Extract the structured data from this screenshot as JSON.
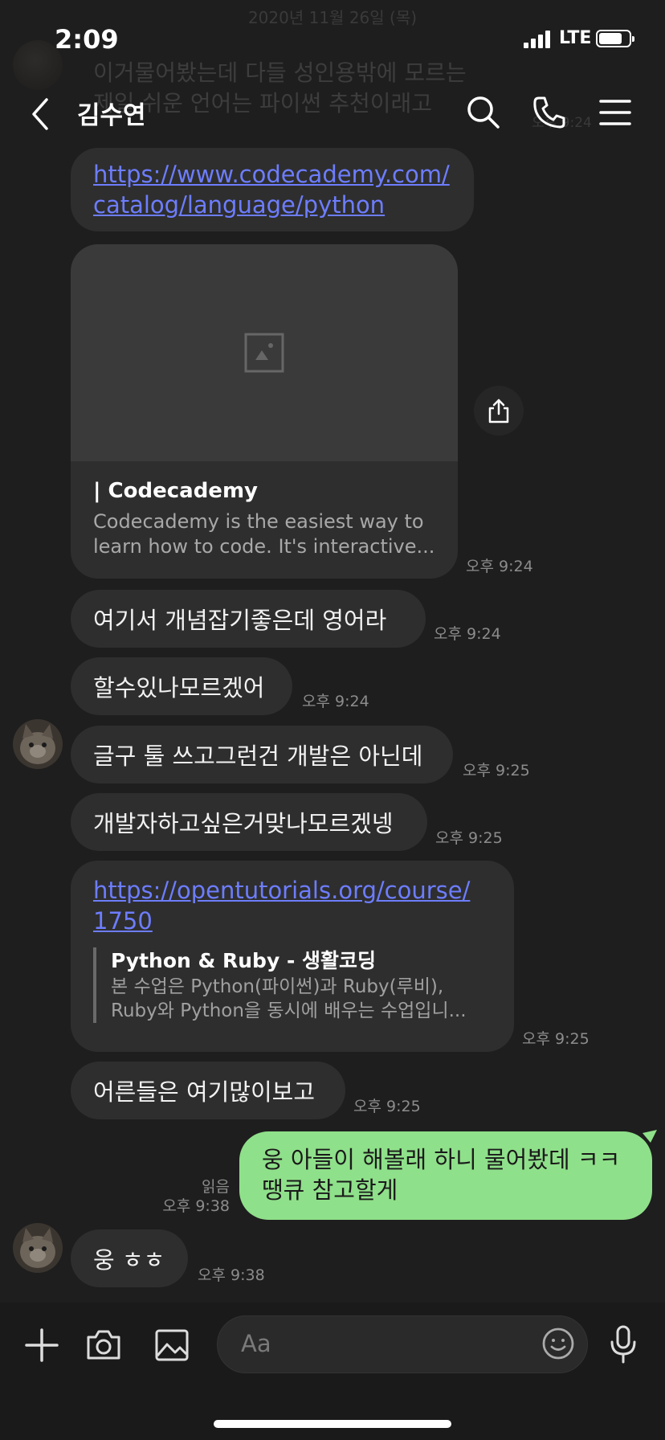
{
  "status_bar": {
    "time": "2:09",
    "network": "LTE"
  },
  "background": {
    "date": "2020년 11월 26일 (목)",
    "prev_message_line1": "이거물어봤는데 다들 성인용밖에 모르는",
    "prev_message_line2": "제일 쉬운 언어는 파이썬 추천이래고",
    "prev_time": "오후 9:24"
  },
  "header": {
    "title": "김수연",
    "icons": [
      "back-icon",
      "search-icon",
      "phone-icon",
      "menu-icon"
    ]
  },
  "messages": {
    "link1": {
      "line1": "https://www.codecademy.com/",
      "line2": "catalog/language/python"
    },
    "card1": {
      "title": " | Codecademy",
      "desc_line1": "Codecademy is the easiest way to",
      "desc_line2": "learn how to code. It's interactive...",
      "time": "오후 9:24"
    },
    "m1": {
      "text": "여기서 개념잡기좋은데 영어라",
      "time": "오후 9:24"
    },
    "m2": {
      "text": "할수있나모르겠어",
      "time": "오후 9:24"
    },
    "m3": {
      "text": "글구 툴 쓰고그런건 개발은 아닌데",
      "time": "오후 9:25"
    },
    "m4": {
      "text": "개발자하고싶은거맞나모르겠넹",
      "time": "오후 9:25"
    },
    "link2": {
      "line1": "https://opentutorials.org/course/",
      "line2": "1750",
      "preview_title": "Python & Ruby - 생활코딩",
      "preview_line1": "본 수업은 Python(파이썬)과 Ruby(루비),",
      "preview_line2": "Ruby와 Python을 동시에 배우는 수업입니...",
      "time": "오후 9:25"
    },
    "m5": {
      "text": "어른들은 여기많이보고",
      "time": "오후 9:25"
    },
    "mine": {
      "line1": "웅 아들이 해볼래 하니 물어봤데 ㅋㅋ",
      "line2": "땡큐 참고할게",
      "read": "읽음",
      "time": "오후 9:38"
    },
    "m6": {
      "text": "웅 ㅎㅎ",
      "time": "오후 9:38"
    }
  },
  "composer": {
    "placeholder": "Aa",
    "icons": [
      "plus-icon",
      "camera-icon",
      "image-icon",
      "emoji-icon",
      "microphone-icon"
    ]
  },
  "colors": {
    "background": "#1e1e1e",
    "bubble": "#2e2e2e",
    "my_bubble": "#8fe08a",
    "link": "#6d7dff"
  }
}
